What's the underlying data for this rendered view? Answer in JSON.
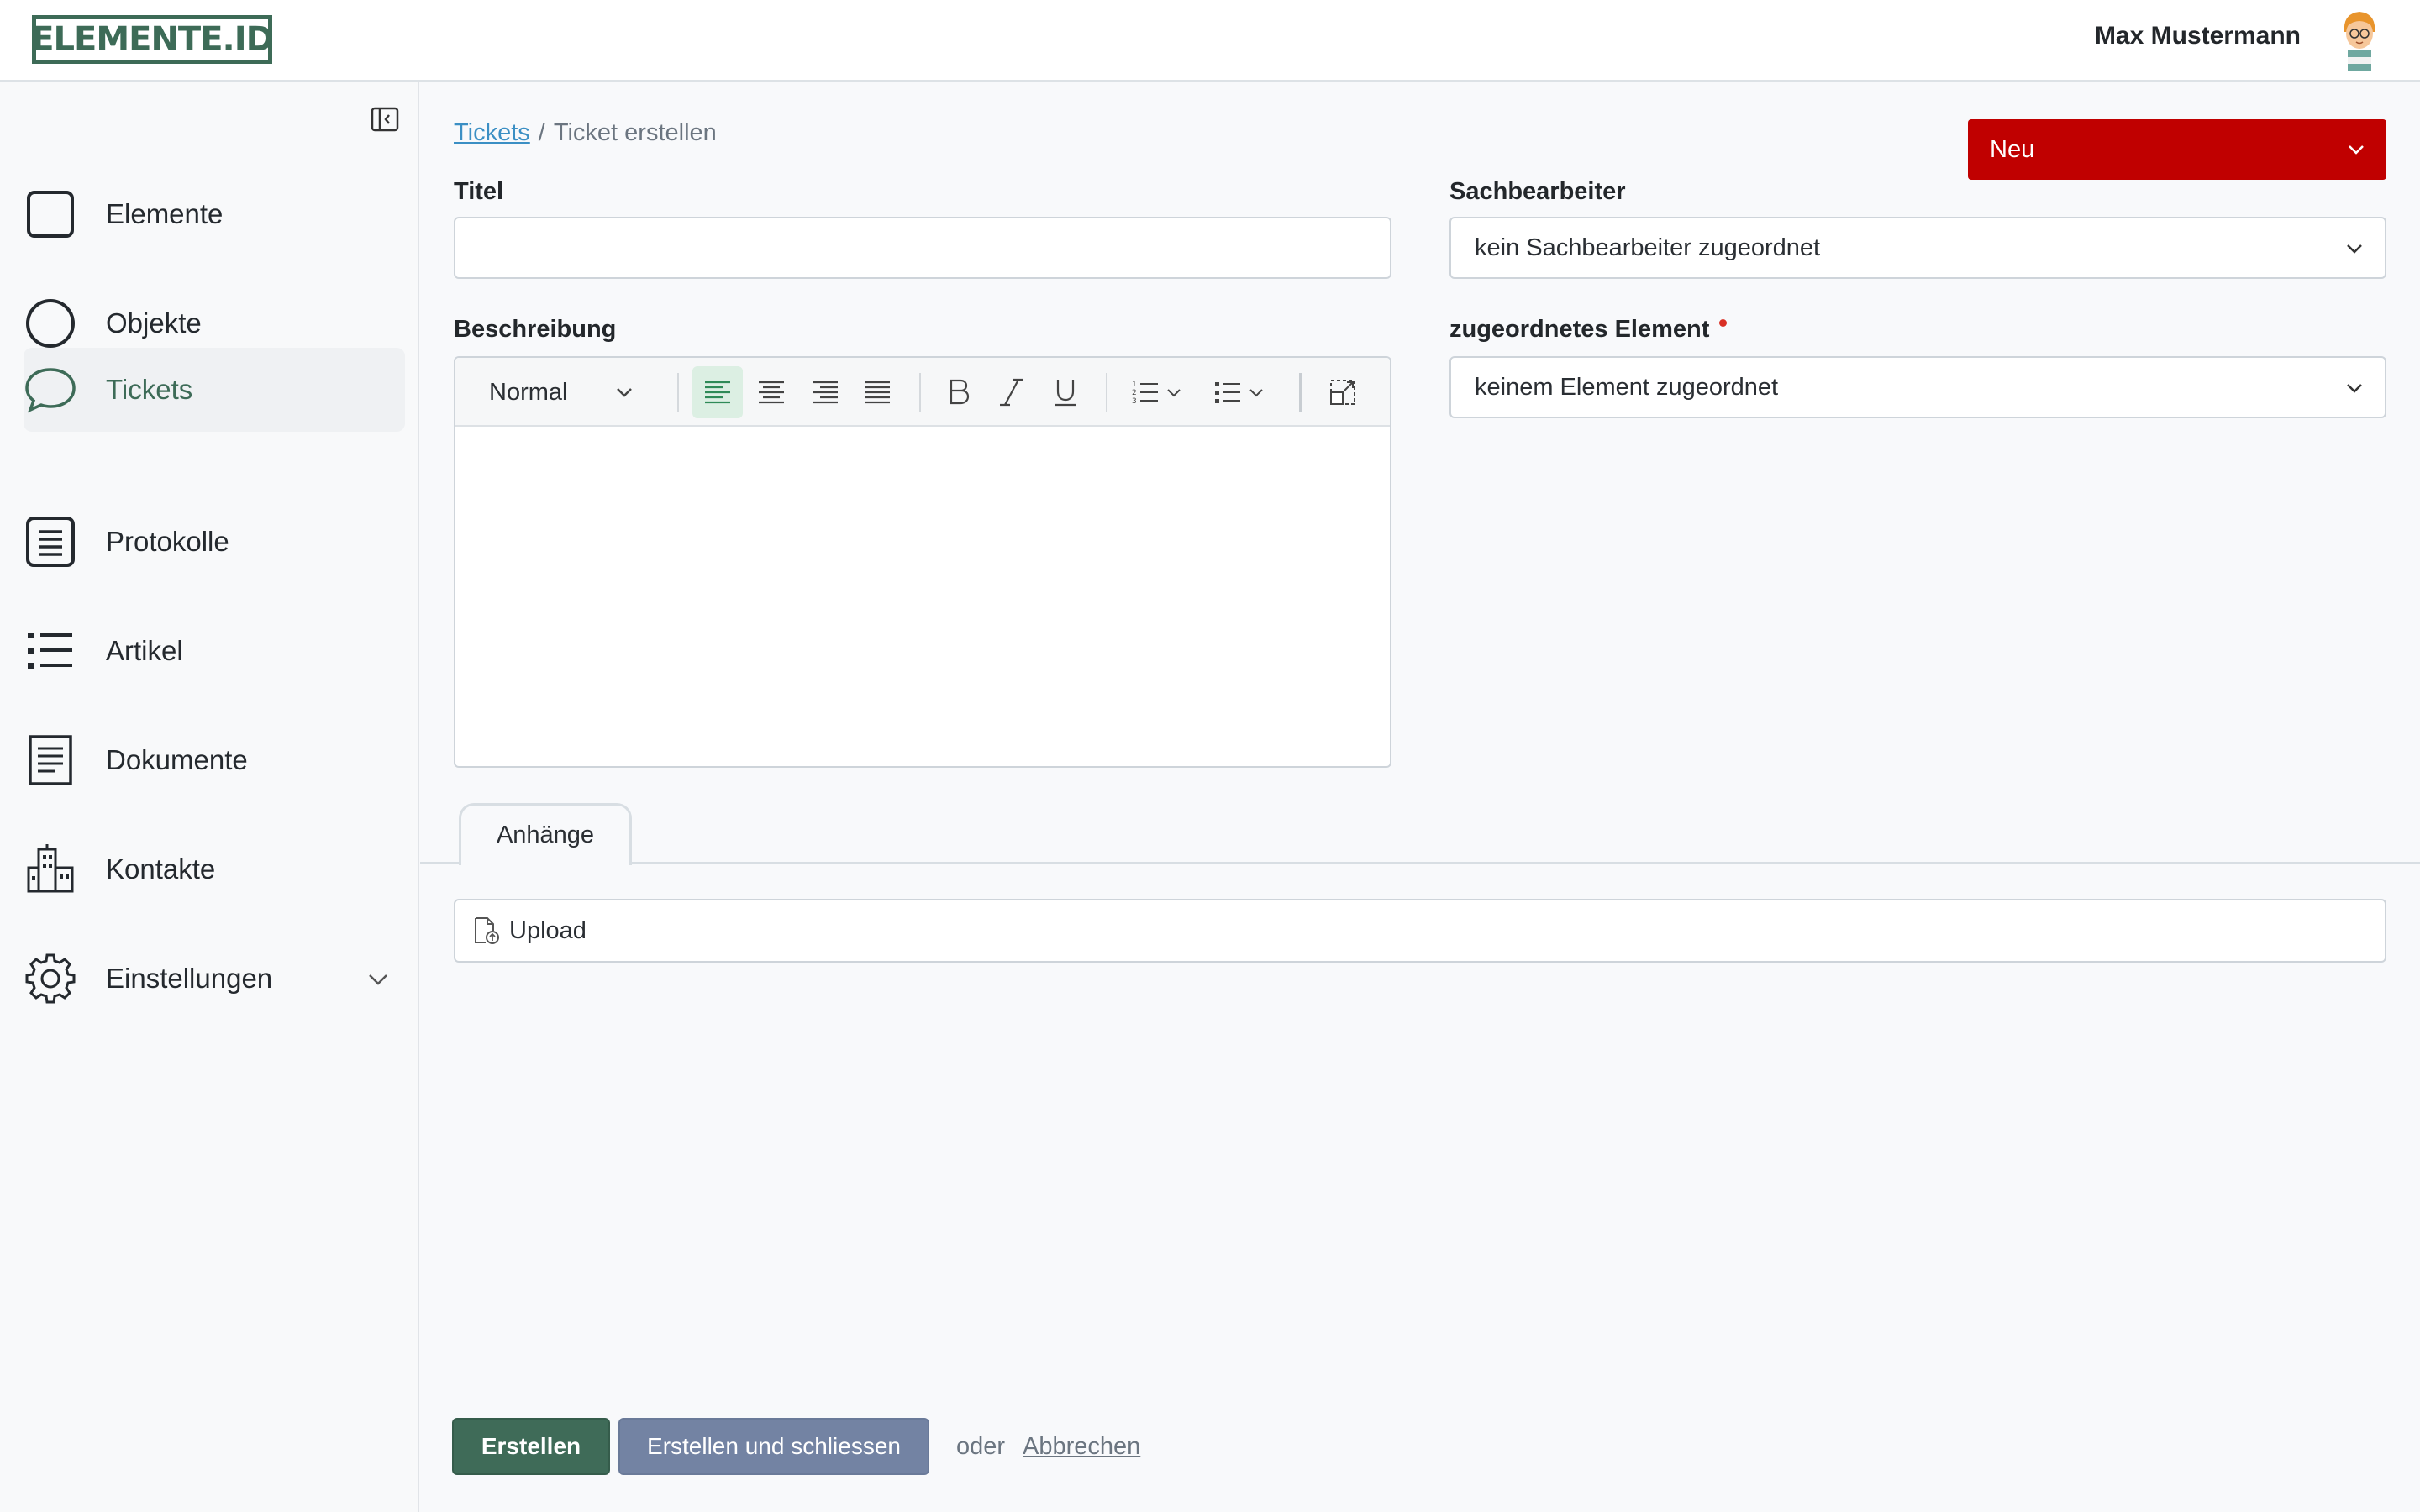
{
  "header": {
    "logo_text": "ELEMENTE.ID",
    "user_name": "Max Mustermann"
  },
  "sidebar": {
    "items": [
      {
        "label": "Elemente",
        "icon": "square-icon"
      },
      {
        "label": "Objekte",
        "icon": "circle-icon"
      },
      {
        "label": "Tickets",
        "icon": "chat-bubble-icon",
        "active": true
      },
      {
        "label": "Protokolle",
        "icon": "protocol-list-icon"
      },
      {
        "label": "Artikel",
        "icon": "bullet-list-icon"
      },
      {
        "label": "Dokumente",
        "icon": "document-icon"
      },
      {
        "label": "Kontakte",
        "icon": "building-icon"
      },
      {
        "label": "Einstellungen",
        "icon": "gear-icon"
      }
    ]
  },
  "breadcrumb": {
    "link": "Tickets",
    "separator": "/",
    "current": "Ticket erstellen"
  },
  "status": {
    "value": "Neu",
    "color": "#c00000"
  },
  "form": {
    "title_label": "Titel",
    "title_value": "",
    "description_label": "Beschreibung",
    "editor_format": "Normal",
    "assignee_label": "Sachbearbeiter",
    "assignee_value": "kein Sachbearbeiter zugeordnet",
    "element_label": "zugeordnetes Element",
    "element_value": "keinem Element zugeordnet"
  },
  "tabs": {
    "attachments": "Anhänge"
  },
  "upload": {
    "label": "Upload"
  },
  "actions": {
    "create": "Erstellen",
    "create_close": "Erstellen und schliessen",
    "or": "oder",
    "cancel": "Abbrechen"
  },
  "colors": {
    "accent": "#3d6b57",
    "status": "#c00000",
    "secondary_button": "#7383a3",
    "link": "#3b8fc4"
  }
}
